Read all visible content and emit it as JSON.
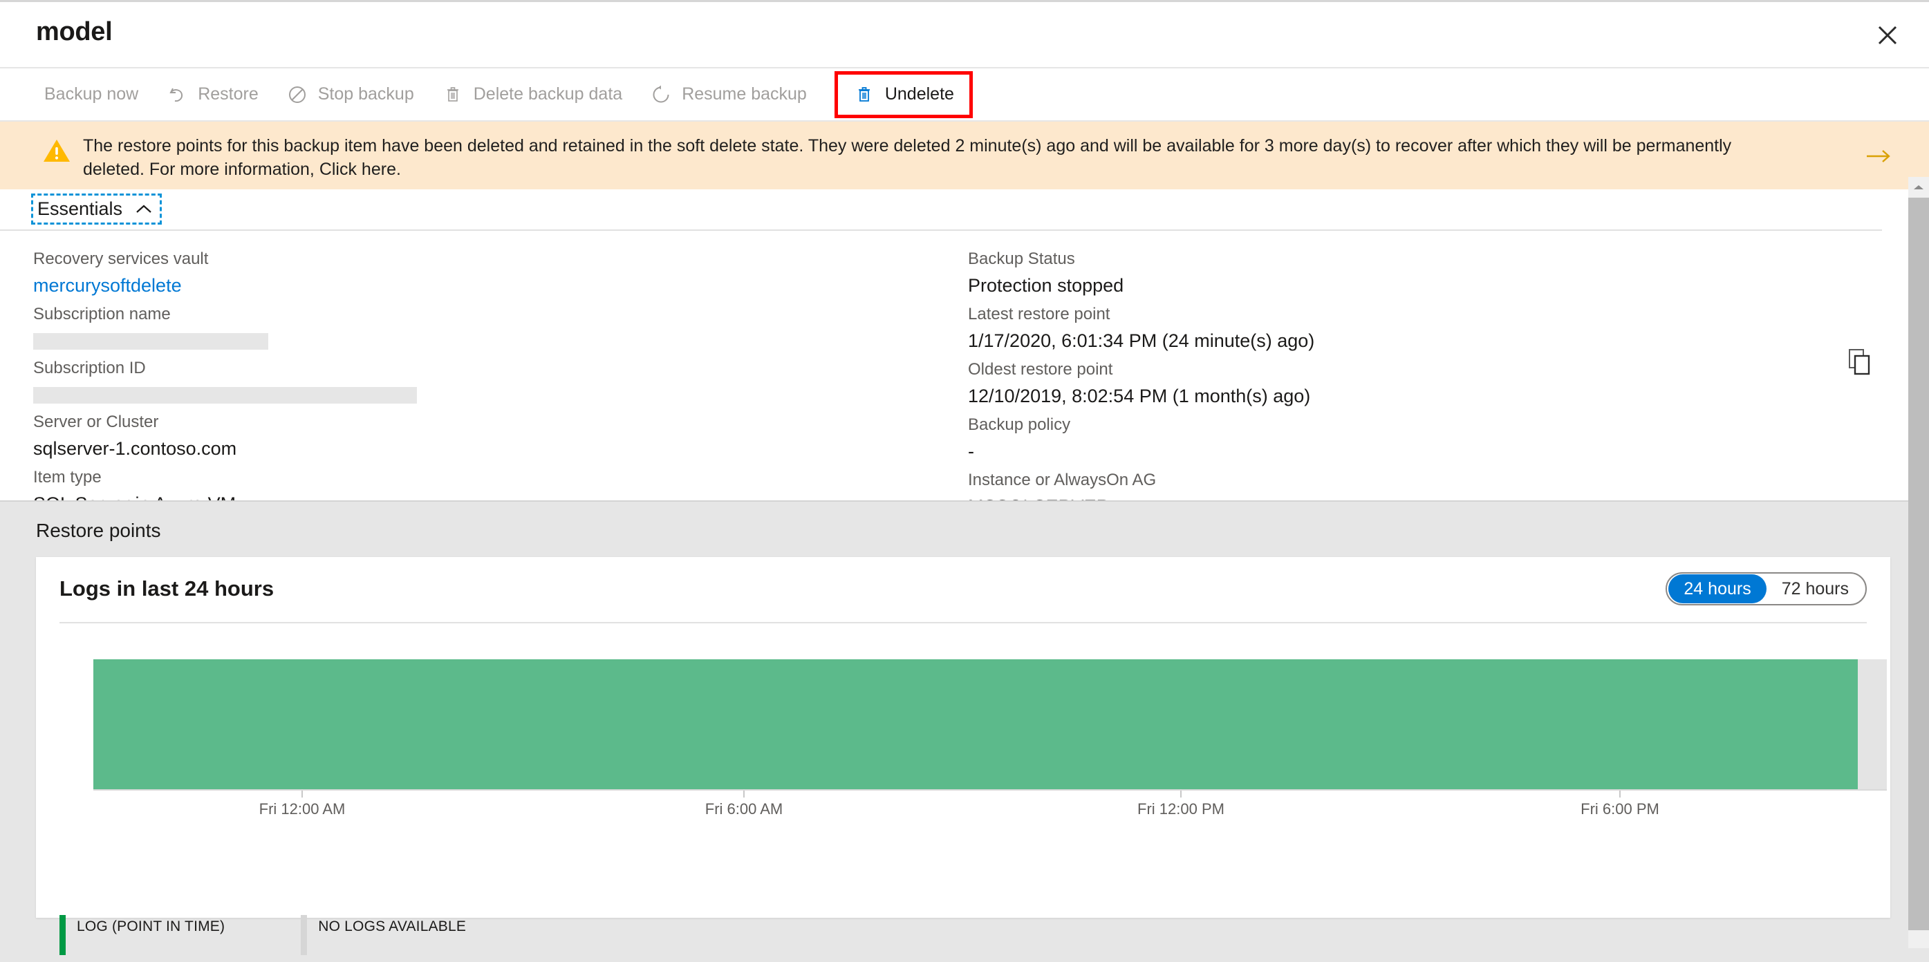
{
  "blade": {
    "title": "model",
    "close_icon": "close-icon"
  },
  "commandbar": {
    "items": [
      {
        "label": "Backup now",
        "icon": "",
        "enabled": false
      },
      {
        "label": "Restore",
        "icon": "restore-icon",
        "enabled": false
      },
      {
        "label": "Stop backup",
        "icon": "stop-backup-icon",
        "enabled": false
      },
      {
        "label": "Delete backup data",
        "icon": "trash-icon",
        "enabled": false
      },
      {
        "label": "Resume backup",
        "icon": "resume-icon",
        "enabled": false
      },
      {
        "label": "Undelete",
        "icon": "trash-icon-blue",
        "enabled": true
      }
    ]
  },
  "banner": {
    "icon": "warning-icon",
    "text": "The restore points for this backup item have been deleted and retained in the soft delete state. They were deleted 2 minute(s) ago and will be available for 3 more day(s) to recover after which they will be permanently deleted. For more information, Click here.",
    "arrow_icon": "arrow-right-icon",
    "background": "#fde8cd",
    "icon_color": "#ffb900"
  },
  "essentials": {
    "label": "Essentials",
    "chevron": "chevron-up-icon",
    "left_fields": [
      {
        "label": "Recovery services vault",
        "value": "mercurysoftdelete",
        "type": "link"
      },
      {
        "label": "Subscription name",
        "value": "",
        "type": "redacted",
        "width": "w1"
      },
      {
        "label": "Subscription ID",
        "value": "",
        "type": "redacted",
        "width": "w2"
      },
      {
        "label": "Server or Cluster",
        "value": "sqlserver-1.contoso.com",
        "type": "text"
      },
      {
        "label": "Item type",
        "value": "SQL Server in Azure VM",
        "type": "text"
      }
    ],
    "right_fields": [
      {
        "label": "Backup Status",
        "value": "Protection stopped"
      },
      {
        "label": "Latest restore point",
        "value": "1/17/2020, 6:01:34 PM (24 minute(s) ago)"
      },
      {
        "label": "Oldest restore point",
        "value": "12/10/2019, 8:02:54 PM (1 month(s) ago)"
      },
      {
        "label": "Backup policy",
        "value": "-"
      },
      {
        "label": "Instance or AlwaysOn AG",
        "value": "MSSQLSERVER"
      }
    ],
    "copy_icon": "copy-icon"
  },
  "restore_points": {
    "section_title": "Restore points",
    "range_options": [
      {
        "label": "24 hours",
        "active": true
      },
      {
        "label": "72 hours",
        "active": false
      }
    ]
  },
  "chart_data": {
    "type": "bar",
    "title": "Logs in last 24 hours",
    "xlabel": "",
    "ylabel": "",
    "grid": false,
    "legend_position": "bottom-left",
    "x_tick_labels": [
      "Fri 12:00 AM",
      "Fri 6:00 AM",
      "Fri 12:00 PM",
      "Fri 6:00 PM"
    ],
    "x_tick_positions_pct": [
      11.6,
      36.2,
      60.6,
      85.2
    ],
    "series": [
      {
        "name": "LOG (POINT IN TIME)",
        "color": "#5cba8b",
        "coverage_pct": 98.4,
        "start_pct": 0,
        "end_pct": 98.4
      },
      {
        "name": "NO LOGS AVAILABLE",
        "color": "#e4e4e4",
        "coverage_pct": 1.6,
        "start_pct": 98.4,
        "end_pct": 100
      }
    ],
    "legend": [
      {
        "label": "LOG (POINT IN TIME)",
        "color": "#009944"
      },
      {
        "label": "NO LOGS AVAILABLE",
        "color": "#d6d6d6"
      }
    ]
  },
  "scrollbar": {
    "up_arrow_icon": "caret-up-icon"
  }
}
